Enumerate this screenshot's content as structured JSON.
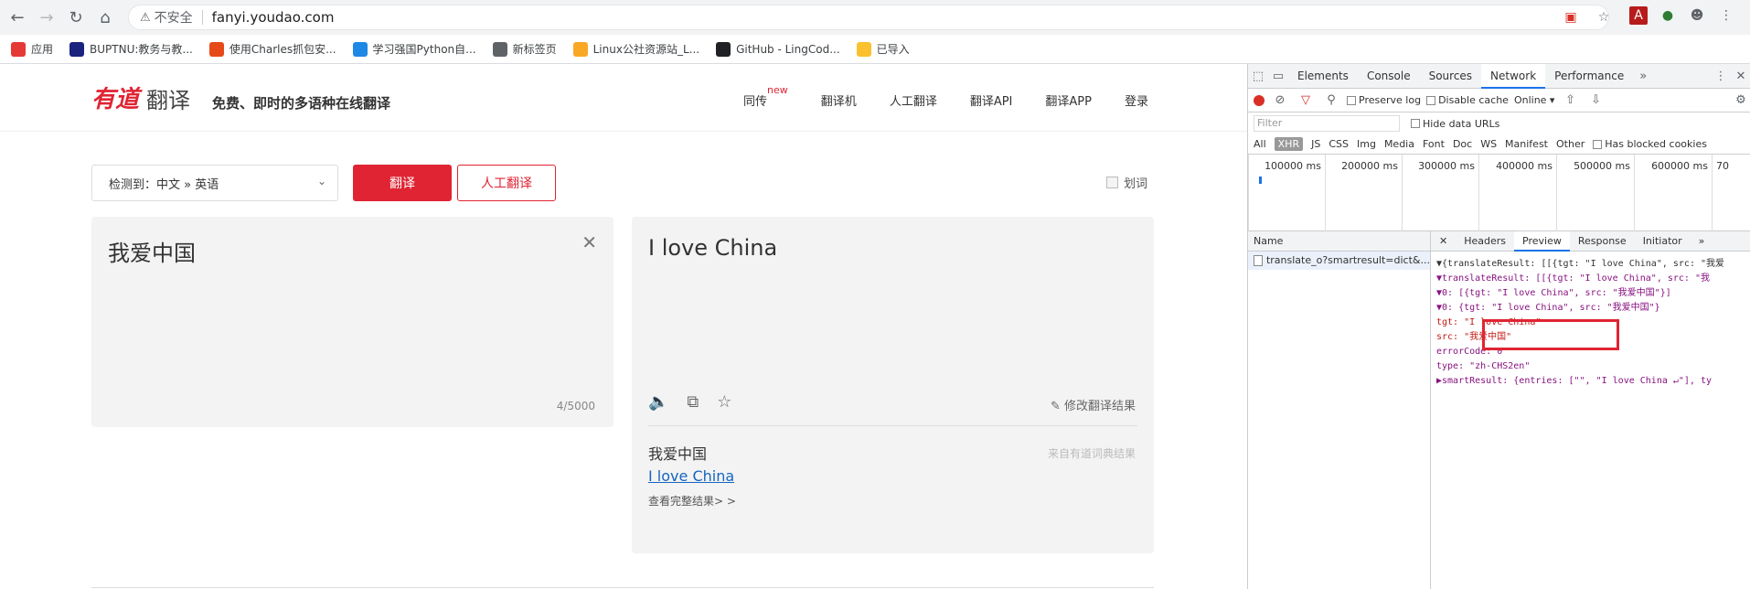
{
  "browser": {
    "url": "fanyi.youdao.com",
    "insecure_label": "不安全",
    "bookmarks": [
      {
        "label": "应用",
        "icon": "apps-icon",
        "color": "#e53935"
      },
      {
        "label": "BUPTNU:教务与教...",
        "icon": "buptnu-icon",
        "color": "#1a237e"
      },
      {
        "label": "使用Charles抓包安...",
        "icon": "charles-icon",
        "color": "#e64a19"
      },
      {
        "label": "学习强国Python自...",
        "icon": "xuexi-icon",
        "color": "#1e88e5"
      },
      {
        "label": "新标签页",
        "icon": "globe-icon",
        "color": "#5f6368"
      },
      {
        "label": "Linux公社资源站_L...",
        "icon": "linux-icon",
        "color": "#f9a825"
      },
      {
        "label": "GitHub - LingCod...",
        "icon": "github-icon",
        "color": "#202124"
      },
      {
        "label": "已导入",
        "icon": "folder-icon",
        "color": "#fbc02d"
      }
    ]
  },
  "site": {
    "logo_youdao": "有道",
    "logo_fanyi": "翻译",
    "slogan": "免费、即时的多语种在线翻译",
    "nav": [
      {
        "label": "同传",
        "sup": "new"
      },
      {
        "label": "翻译机",
        "sup": ""
      },
      {
        "label": "人工翻译",
        "sup": ""
      },
      {
        "label": "翻译API",
        "sup": ""
      },
      {
        "label": "翻译APP",
        "sup": ""
      },
      {
        "label": "登录",
        "sup": ""
      }
    ],
    "lang_select": "检测到：中文 » 英语",
    "translate_button": "翻译",
    "human_button": "人工翻译",
    "word_select_label": "划词",
    "source_text": "我爱中国",
    "char_count": "4/5000",
    "target_text": "I love China",
    "edit_result": "修改翻译结果",
    "dict_source": "我爱中国",
    "dict_from": "来自有道词典结果",
    "dict_link": "I love China",
    "dict_more": "查看完整结果> >"
  },
  "devtools": {
    "tabs": [
      "Elements",
      "Console",
      "Sources",
      "Network",
      "Performance"
    ],
    "active_tab": "Network",
    "toolbar": {
      "preserve_log": "Preserve log",
      "disable_cache": "Disable cache",
      "throttle": "Online"
    },
    "filter_placeholder": "Filter",
    "hide_data_urls": "Hide data URLs",
    "types": [
      "All",
      "XHR",
      "JS",
      "CSS",
      "Img",
      "Media",
      "Font",
      "Doc",
      "WS",
      "Manifest",
      "Other"
    ],
    "has_blocked": "Has blocked cookies",
    "timeline_ticks": [
      "100000 ms",
      "200000 ms",
      "300000 ms",
      "400000 ms",
      "500000 ms",
      "600000 ms",
      "70"
    ],
    "name_header": "Name",
    "request_name": "translate_o?smartresult=dict&...",
    "preview_tabs": [
      "Headers",
      "Preview",
      "Response",
      "Initiator"
    ],
    "active_preview_tab": "Preview",
    "json_lines": [
      "▼{translateResult: [[{tgt: \"I love China\", src: \"我爱",
      "  ▼translateResult: [[{tgt: \"I love China\", src: \"我",
      "    ▼0: [{tgt: \"I love China\", src: \"我爱中国\"}]",
      "      ▼0: {tgt: \"I love China\", src: \"我爱中国\"}",
      "          tgt: \"I love China\"",
      "          src: \"我爱中国\"",
      "    errorCode: 0",
      "    type: \"zh-CHS2en\"",
      "  ▶smartResult: {entries: [\"\", \"I love China ↵\"], ty"
    ]
  }
}
